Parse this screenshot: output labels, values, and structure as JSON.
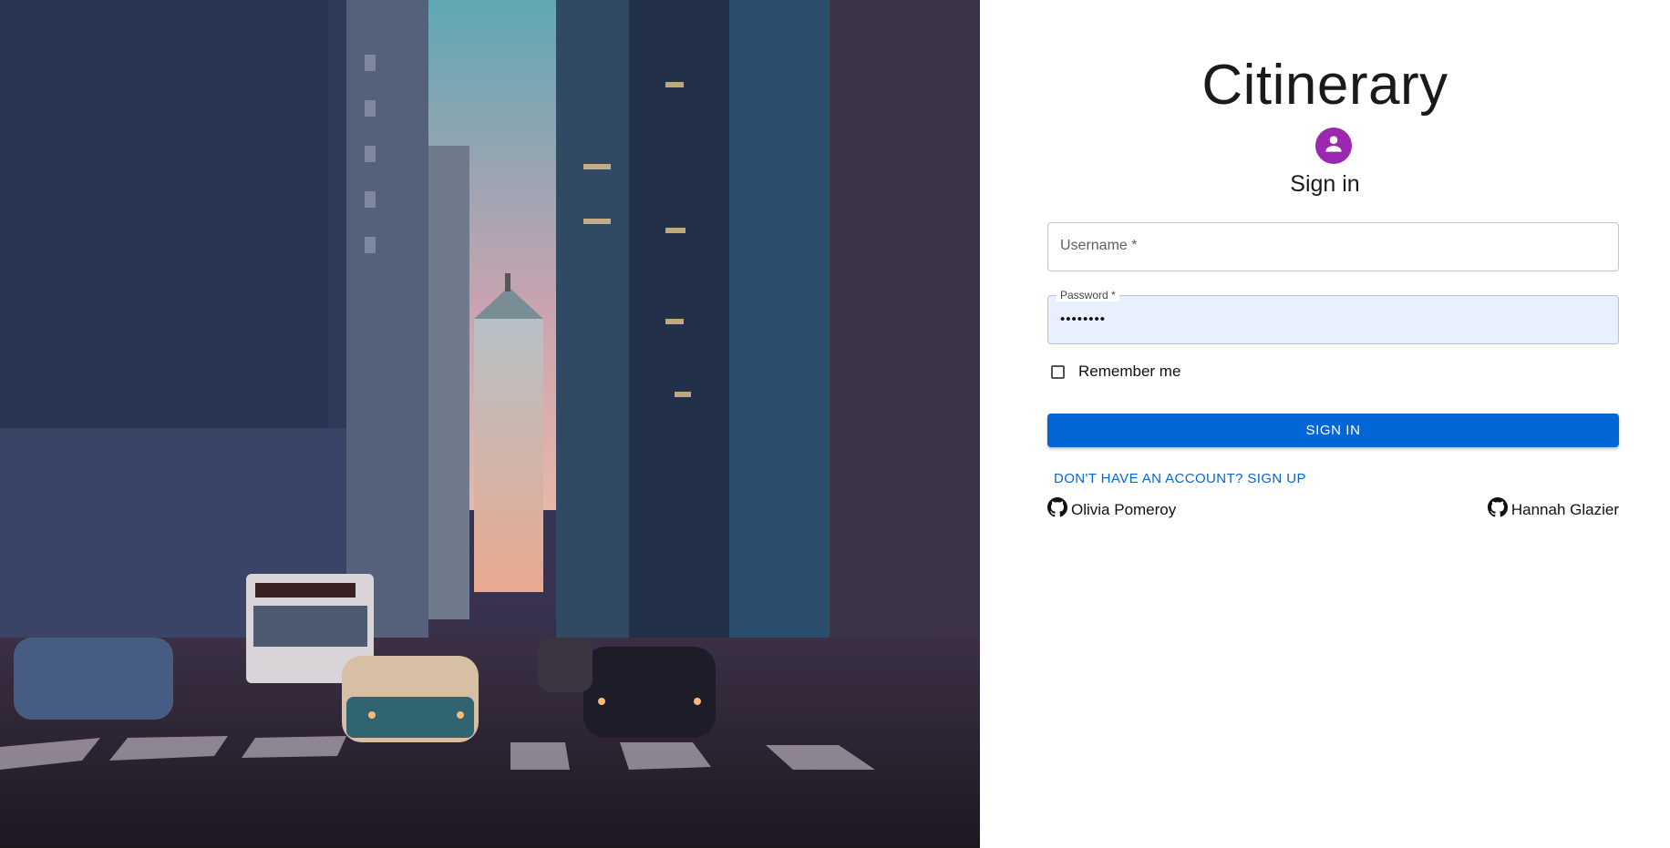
{
  "hero": {
    "image_description_icon": "city-street-photo"
  },
  "app": {
    "title": "Citinerary"
  },
  "signin": {
    "heading": "Sign in",
    "avatar_icon": "person-icon",
    "avatar_color": "#9c27b0"
  },
  "form": {
    "username_label": "Username *",
    "password_label": "Password *",
    "password_value": "••••••••",
    "remember_label": "Remember me",
    "remember_checked": false,
    "submit_label": "SIGN IN",
    "submit_color": "#0366d6"
  },
  "links": {
    "signup": "DON'T HAVE AN ACCOUNT? SIGN UP"
  },
  "authors": [
    {
      "name": "Olivia Pomeroy",
      "icon": "github-icon"
    },
    {
      "name": "Hannah Glazier",
      "icon": "github-icon"
    }
  ]
}
